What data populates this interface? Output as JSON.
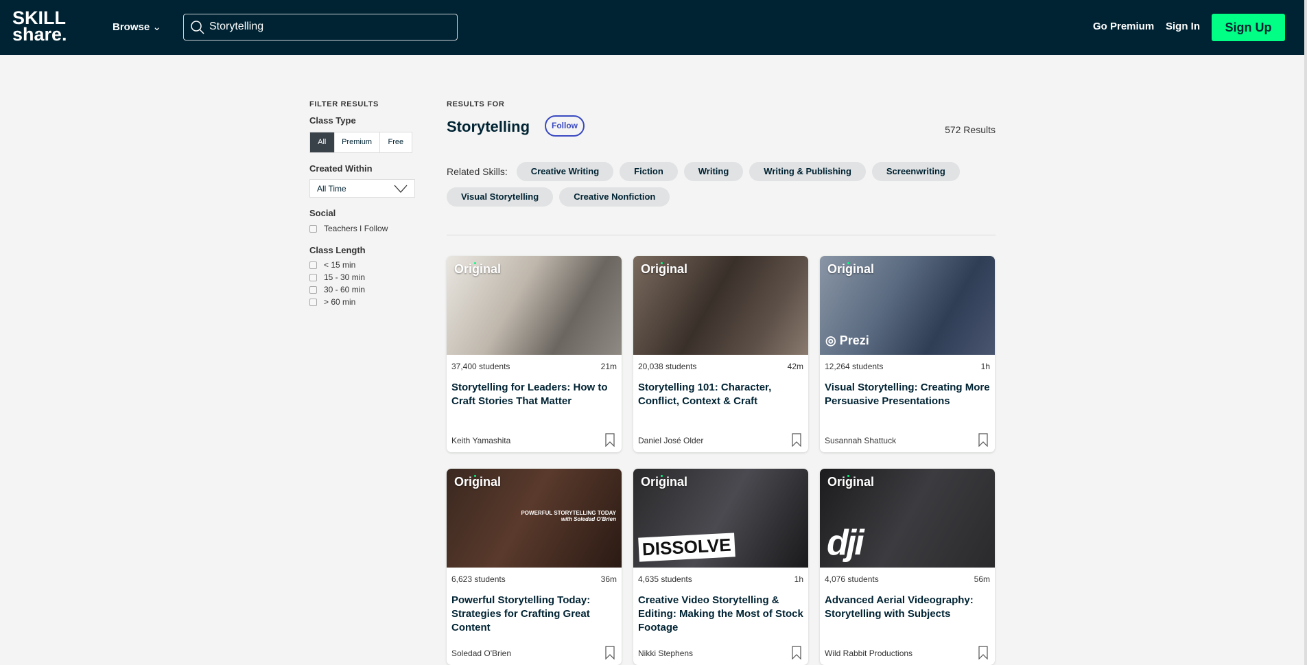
{
  "header": {
    "logo": "SKILL share.",
    "browse": "Browse",
    "search_value": "Storytelling",
    "go_premium": "Go Premium",
    "sign_in": "Sign In",
    "sign_up": "Sign Up"
  },
  "filters": {
    "heading": "FILTER RESULTS",
    "class_type": {
      "label": "Class Type",
      "options": [
        "All",
        "Premium",
        "Free"
      ],
      "selected": "All"
    },
    "created_within": {
      "label": "Created Within",
      "value": "All Time"
    },
    "social": {
      "label": "Social",
      "options": [
        "Teachers I Follow"
      ]
    },
    "class_length": {
      "label": "Class Length",
      "options": [
        "< 15 min",
        "15 - 30 min",
        "30 - 60 min",
        "> 60 min"
      ]
    }
  },
  "results": {
    "heading": "RESULTS FOR",
    "query": "Storytelling",
    "follow": "Follow",
    "count": "572 Results",
    "related_label": "Related Skills:",
    "related": [
      "Creative Writing",
      "Fiction",
      "Writing",
      "Writing & Publishing",
      "Screenwriting",
      "Visual Storytelling",
      "Creative Nonfiction"
    ]
  },
  "colors": {
    "header": "#002333",
    "accent": "#00ff84",
    "follow": "#3a49c1"
  },
  "cards": [
    {
      "badge": "Original",
      "students": "37,400 students",
      "duration": "21m",
      "title": "Storytelling for Leaders: How to Craft Stories That Matter",
      "teacher": "Keith Yamashita",
      "overlay": ""
    },
    {
      "badge": "Original",
      "students": "20,038 students",
      "duration": "42m",
      "title": "Storytelling 101: Character, Conflict, Context & Craft",
      "teacher": "Daniel José Older",
      "overlay": ""
    },
    {
      "badge": "Original",
      "students": "12,264 students",
      "duration": "1h",
      "title": "Visual Storytelling: Creating More Persuasive Presentations",
      "teacher": "Susannah Shattuck",
      "overlay": "Prezi"
    },
    {
      "badge": "Original",
      "students": "6,623 students",
      "duration": "36m",
      "title": "Powerful Storytelling Today: Strategies for Crafting Great Content",
      "teacher": "Soledad O'Brien",
      "overlay": "POWERFUL STORYTELLING TODAY with Soledad O'Brien"
    },
    {
      "badge": "Original",
      "students": "4,635 students",
      "duration": "1h",
      "title": "Creative Video Storytelling & Editing: Making the Most of Stock Footage",
      "teacher": "Nikki Stephens",
      "overlay": "DISSOLVE"
    },
    {
      "badge": "Original",
      "students": "4,076 students",
      "duration": "56m",
      "title": "Advanced Aerial Videography: Storytelling with Subjects",
      "teacher": "Wild Rabbit Productions",
      "overlay": "dji"
    }
  ]
}
